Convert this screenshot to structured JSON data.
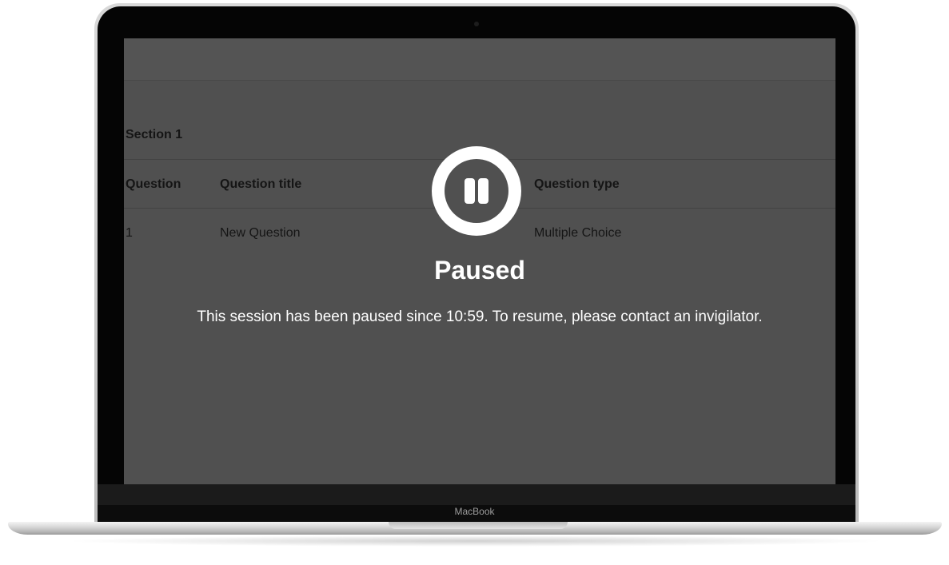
{
  "device": {
    "brand_label": "MacBook"
  },
  "exam": {
    "section_title": "Section 1",
    "table": {
      "headers": [
        "Question",
        "Question title",
        "Question type"
      ],
      "rows": [
        [
          "1",
          "New Question",
          "Multiple Choice"
        ]
      ]
    }
  },
  "overlay": {
    "icon": "pause-icon",
    "title": "Paused",
    "message": "This session has been paused since 10:59. To resume, please contact an invigilator."
  },
  "colors": {
    "overlay_bg": "#505050",
    "overlay_text": "#ffffff",
    "table_text": "#151515"
  }
}
